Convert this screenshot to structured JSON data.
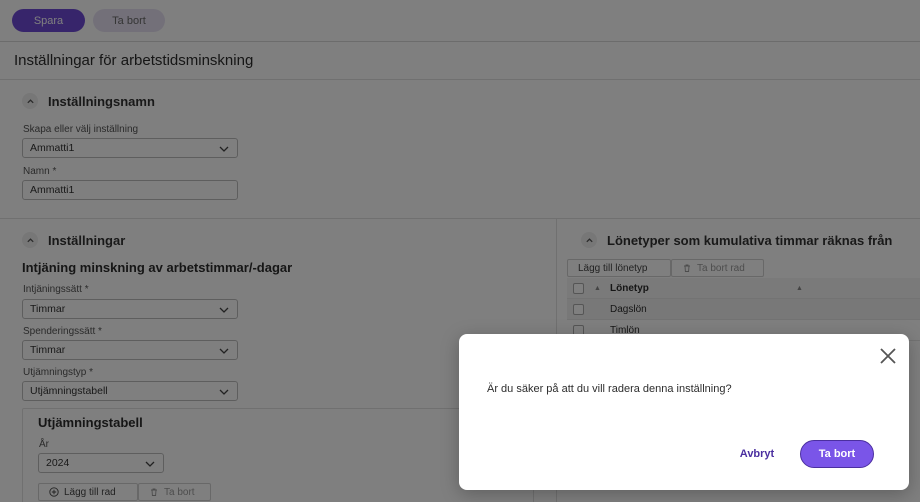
{
  "toolbar": {
    "save_label": "Spara",
    "delete_label": "Ta bort"
  },
  "page": {
    "title": "Inställningar för arbetstidsminskning"
  },
  "setting_name_section": {
    "heading": "Inställningsnamn",
    "select_label": "Skapa eller välj inställning",
    "select_value": "Ammatti1",
    "name_label": "Namn *",
    "name_value": "Ammatti1"
  },
  "settings_section": {
    "heading": "Inställningar",
    "subheading": "Intjäning minskning av arbetstimmar/-dagar",
    "earning_label": "Intjäningssätt *",
    "earning_value": "Timmar",
    "spending_label": "Spenderingssätt *",
    "spending_value": "Timmar",
    "equalization_label": "Utjämningstyp *",
    "equalization_value": "Utjämningstabell",
    "table_box": {
      "heading": "Utjämningstabell",
      "year_label": "År",
      "year_value": "2024",
      "add_row_label": "Lägg till rad",
      "delete_row_label": "Ta bort"
    }
  },
  "wage_types_section": {
    "heading": "Lönetyper som kumulativa timmar räknas från",
    "add_label": "Lägg till lönetyp",
    "delete_label": "Ta bort rad",
    "column_header": "Lönetyp",
    "rows": [
      "Dagslön",
      "Timlön"
    ]
  },
  "dialog": {
    "message": "Är du säker på att du vill radera denna inställning?",
    "cancel_label": "Avbryt",
    "confirm_label": "Ta bort"
  },
  "icons": [
    "chevron-up-icon",
    "chevron-down-icon",
    "plus-circle-icon",
    "trash-icon",
    "close-icon"
  ],
  "colors": {
    "accent": "#6e4bd6",
    "confirm": "#7a55e8",
    "overlay": "rgba(0,0,0,0.5)"
  }
}
